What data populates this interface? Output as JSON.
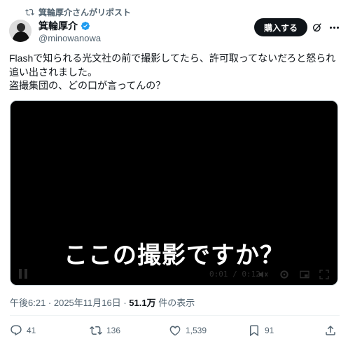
{
  "repost": {
    "text": "箕輪厚介さんがリポスト"
  },
  "author": {
    "name": "箕輪厚介",
    "handle": "@minowanowa"
  },
  "buttons": {
    "buy_label": "購入する"
  },
  "tweet": {
    "lines": [
      "Flashで知られる光文社の前で撮影してたら、許可取ってないだろと怒られ",
      "追い出されました。",
      "盗撮集団の、どの口が言ってんの？"
    ]
  },
  "video": {
    "caption": "ここの撮影ですか？",
    "time": "0:01 / 0:12",
    "progress": 0.08
  },
  "meta": {
    "timestamp": "午後6:21 · 2025年11月16日 · ",
    "views_count": "51.1万",
    "views_suffix": " 件の表示"
  },
  "actions": {
    "replies": "41",
    "reposts": "136",
    "likes": "1,539",
    "bookmarks": "91"
  },
  "colors": {
    "verified": "#1d9bf0",
    "text": "#0f1419",
    "muted": "#536471"
  }
}
